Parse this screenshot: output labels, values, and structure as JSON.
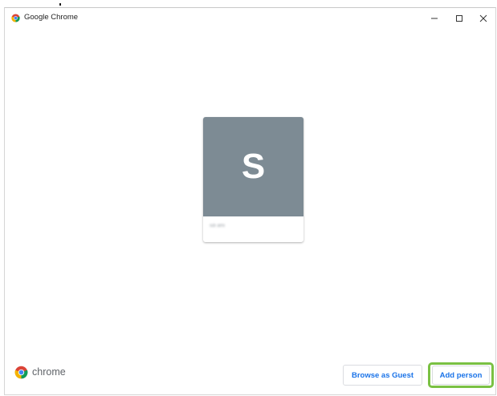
{
  "window": {
    "title": "Google Chrome",
    "controls": {
      "minimize_icon": "minimize-icon",
      "maximize_icon": "maximize-icon",
      "close_icon": "close-icon"
    }
  },
  "profiles": [
    {
      "initial": "S",
      "name": "sdi ami",
      "avatar_color": "#7d8b94"
    }
  ],
  "footer": {
    "brand_text": "chrome",
    "guest_button_label": "Browse as Guest",
    "add_person_button_label": "Add person"
  },
  "colors": {
    "accent": "#1a73e8",
    "highlight": "#7ac143"
  }
}
